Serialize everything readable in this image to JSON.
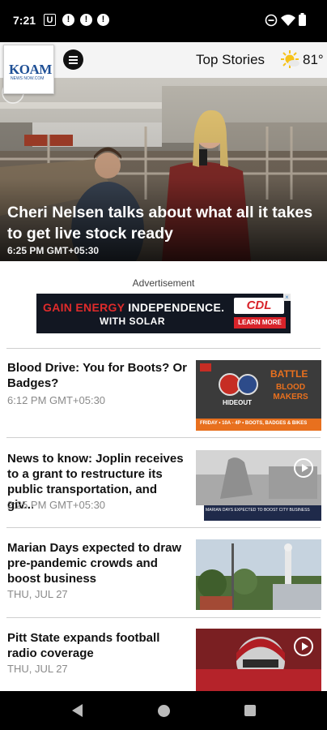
{
  "status_bar": {
    "time": "7:21",
    "left_icons": [
      "u-badge-icon",
      "alert-icon",
      "alert-icon",
      "alert-icon",
      "dot-icon"
    ],
    "right_icons": [
      "do-not-disturb-icon",
      "wifi-icon",
      "battery-icon"
    ],
    "u_badge_text": "U",
    "alert_text": "!"
  },
  "header": {
    "logo_text": "KOAM",
    "logo_subtext": "NEWS NOW.COM",
    "section_title": "Top Stories",
    "temperature": "81°",
    "weather_icon": "partly-sunny-icon"
  },
  "hero": {
    "title": "Cheri Nelsen talks about what all it takes to get live stock ready",
    "time": "6:25 PM GMT+05:30"
  },
  "ad": {
    "label": "Advertisement",
    "line1_red": "GAIN ENERGY",
    "line1_white": " INDEPENDENCE.",
    "line2": "WITH SOLAR",
    "brand": "CDL",
    "cta": "LEARN MORE",
    "close_glyph": "×"
  },
  "stories": [
    {
      "title": "Blood Drive: You for Boots? Or Badges?",
      "time": "6:12 PM GMT+05:30",
      "thumb_text_top": "BATTLE",
      "thumb_text_mid": "BLOOD MAKERS",
      "thumb_text_footer": "FRIDAY • 10A - 4P • BOOTS, BADGES & BIKES",
      "thumb_hideout": "HIDEOUT",
      "has_video": false
    },
    {
      "title": "News to know: Joplin receives to a grant to restructure its public transportation, and giv...",
      "time": "2:25 PM GMT+05:30",
      "thumb_ticker": "MARIAN DAYS EXPECTED TO BOOST CITY BUSINESS",
      "has_video": true
    },
    {
      "title": "Marian Days expected to draw pre-pandemic crowds and boost business",
      "time": "THU, JUL 27",
      "has_video": false
    },
    {
      "title": "Pitt State expands football radio coverage",
      "time": "THU, JUL 27",
      "has_video": true
    }
  ],
  "nav_bar": {
    "buttons": [
      "back-icon",
      "home-icon",
      "recents-icon"
    ]
  }
}
